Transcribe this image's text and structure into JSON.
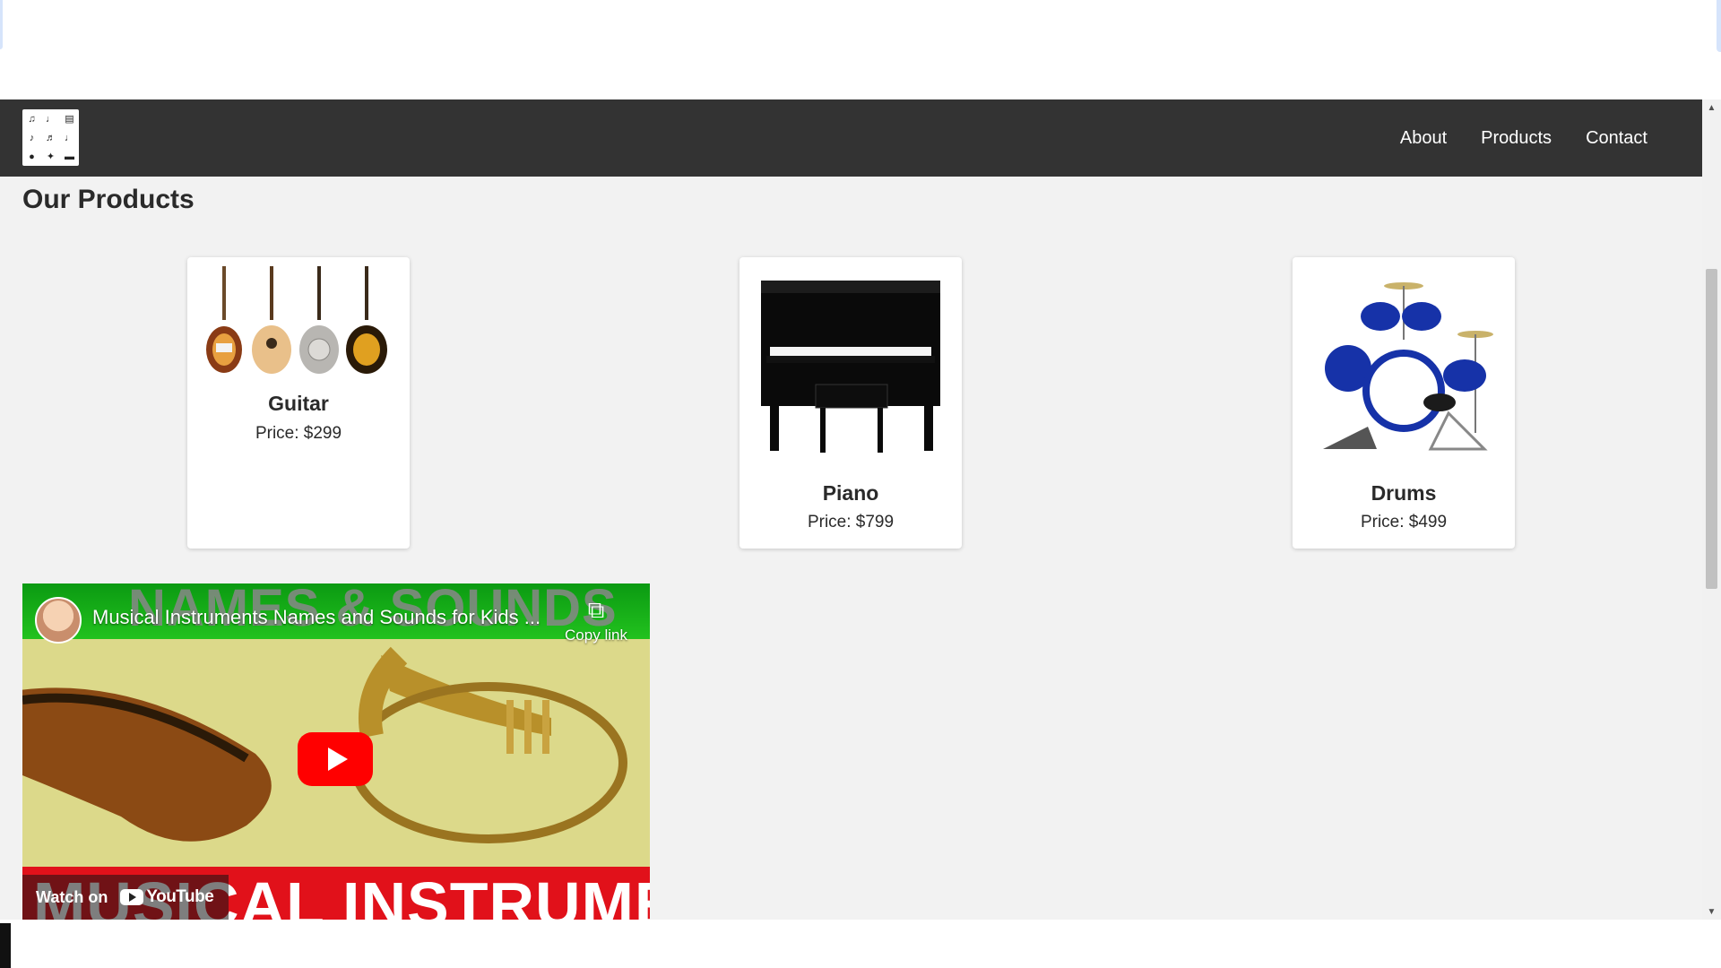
{
  "nav": {
    "logo_alt": "Musical instruments logo",
    "links": [
      "About",
      "Products",
      "Contact"
    ]
  },
  "page_title": "Our Products",
  "products": [
    {
      "name": "Guitar",
      "price": "Price: $299"
    },
    {
      "name": "Piano",
      "price": "Price: $799"
    },
    {
      "name": "Drums",
      "price": "Price: $499"
    }
  ],
  "video": {
    "title": "Musical Instruments Names and Sounds for Kids ...",
    "copy_label": "Copy link",
    "watch_label": "Watch on",
    "youtube_label": "YouTube",
    "thumb_top_text": "NAMES & SOUNDS",
    "thumb_bottom_text": "MUSICAL INSTRUMENTS"
  },
  "icons": {
    "logo": "instrument-grid-icon",
    "copy": "copy-icon",
    "play": "play-icon",
    "youtube": "youtube-icon"
  }
}
